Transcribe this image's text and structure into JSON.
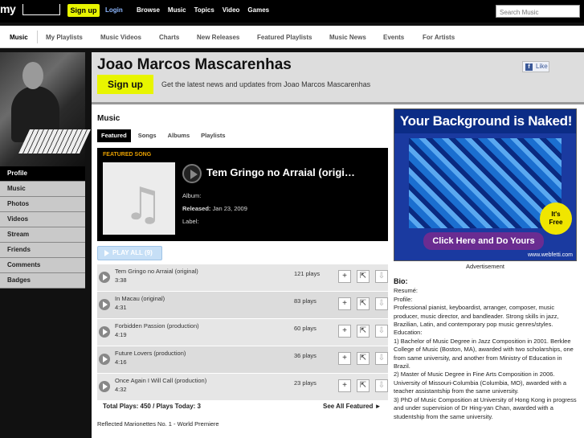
{
  "topbar": {
    "logo": "my",
    "signup": "Sign up",
    "login": "Login",
    "nav": [
      "Browse",
      "Music",
      "Topics",
      "Video",
      "Games"
    ],
    "search_placeholder": "Search Music"
  },
  "subnav": {
    "items": [
      "Music",
      "My Playlists",
      "Music Videos",
      "Charts",
      "New Releases",
      "Featured Playlists",
      "Music News",
      "Events",
      "For Artists"
    ],
    "active": "Music"
  },
  "sidebar": {
    "items": [
      "Profile",
      "Music",
      "Photos",
      "Videos",
      "Stream",
      "Friends",
      "Comments",
      "Badges"
    ],
    "active": "Profile"
  },
  "header": {
    "artist_name": "Joao Marcos Mascarenhas",
    "signup": "Sign up",
    "tagline": "Get the latest news and updates from Joao Marcos Mascarenhas",
    "like": "Like"
  },
  "music": {
    "title": "Music",
    "tabs": [
      "Featured",
      "Songs",
      "Albums",
      "Playlists"
    ],
    "active_tab": "Featured",
    "featured_label": "FEATURED SONG",
    "featured_title": "Tem Gringo no Arraial (origi…",
    "album_label": "Album:",
    "album_value": "",
    "released_label": "Released:",
    "released_value": "Jan 23, 2009",
    "label_label": "Label:",
    "label_value": "",
    "play_all": "PLAY ALL (9)",
    "tracks": [
      {
        "name": "Tem Gringo no Arraial (original)",
        "duration": "3:38",
        "plays": "121 plays"
      },
      {
        "name": "In Macau (original)",
        "duration": "4:31",
        "plays": "83 plays"
      },
      {
        "name": "Forbidden Passion (production)",
        "duration": "4:19",
        "plays": "60 plays"
      },
      {
        "name": "Future Lovers (production)",
        "duration": "4:16",
        "plays": "36 plays"
      },
      {
        "name": "Once Again I Will Call (production)",
        "duration": "4:32",
        "plays": "23 plays"
      }
    ],
    "totals": "Total Plays: 450 / Plays Today: 3",
    "see_all": "See All Featured ►",
    "other_item": "Reflected Marionettes No. 1 - World Premiere"
  },
  "ad": {
    "headline": "Your Background is Naked!",
    "badge_line1": "It's",
    "badge_line2": "Free",
    "cta": "Click Here and Do Yours",
    "url": "www.webfetti.com",
    "label": "Advertisement"
  },
  "bio": {
    "title": "Bio:",
    "lines": [
      "Resumé:",
      "",
      "Profile:",
      "Professional pianist, keyboardist, arranger, composer, music producer, music director, and bandleader. Strong skills in jazz, Brazilian, Latin, and contemporary pop music genres/styles.",
      "",
      "Education:",
      "1) Bachelor of Music Degree in Jazz Composition in 2001. Berklee College of Music (Boston, MA), awarded with two scholarships, one from same university, and another from Ministry of Education in Brazil.",
      "2) Master of Music Degree in Fine Arts Composition in 2006. University of Missouri-Columbia (Columbia, MO), awarded with a teacher assistantship from the same university.",
      "3) PhD of Music Composition at University of Hong Kong in progress and under supervision of Dr Hing-yan Chan, awarded with a studentship from the same university."
    ]
  }
}
